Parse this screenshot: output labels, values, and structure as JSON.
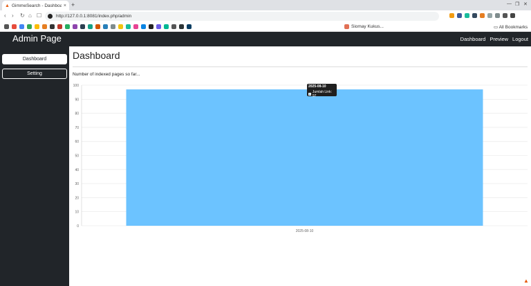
{
  "browser": {
    "tab_title": "GimmeSearch - Dashboard",
    "tab_close": "×",
    "new_tab": "+",
    "url": "http://127.0.0.1:8081/index.php/admin",
    "bookmark_folder": "Siomay Kukus...",
    "all_bookmarks": "All Bookmarks"
  },
  "sidebar": {
    "brand": "Admin Page",
    "items": [
      {
        "label": "Dashboard",
        "active": true
      },
      {
        "label": "Setting",
        "active": false
      }
    ]
  },
  "topnav": {
    "links": [
      "Dashboard",
      "Preview",
      "Logout"
    ]
  },
  "main": {
    "title": "Dashboard",
    "subtitle": "Number of indexed pages so far..."
  },
  "tooltip": {
    "date": "2025-08-10",
    "label": "Jumlah Link: 97"
  },
  "colors": {
    "bar_fill": "#6cc3ff",
    "sidebar_bg": "#212529",
    "grid": "#e6e6e6"
  },
  "chart_data": {
    "type": "bar",
    "categories": [
      "2025-08-10"
    ],
    "series": [
      {
        "name": "Jumlah Link",
        "values": [
          97
        ]
      }
    ],
    "ylim": [
      0,
      100
    ],
    "yticks": [
      0,
      10,
      20,
      30,
      40,
      50,
      60,
      70,
      80,
      90,
      100
    ],
    "grid": true,
    "xlabel": "",
    "ylabel": ""
  }
}
